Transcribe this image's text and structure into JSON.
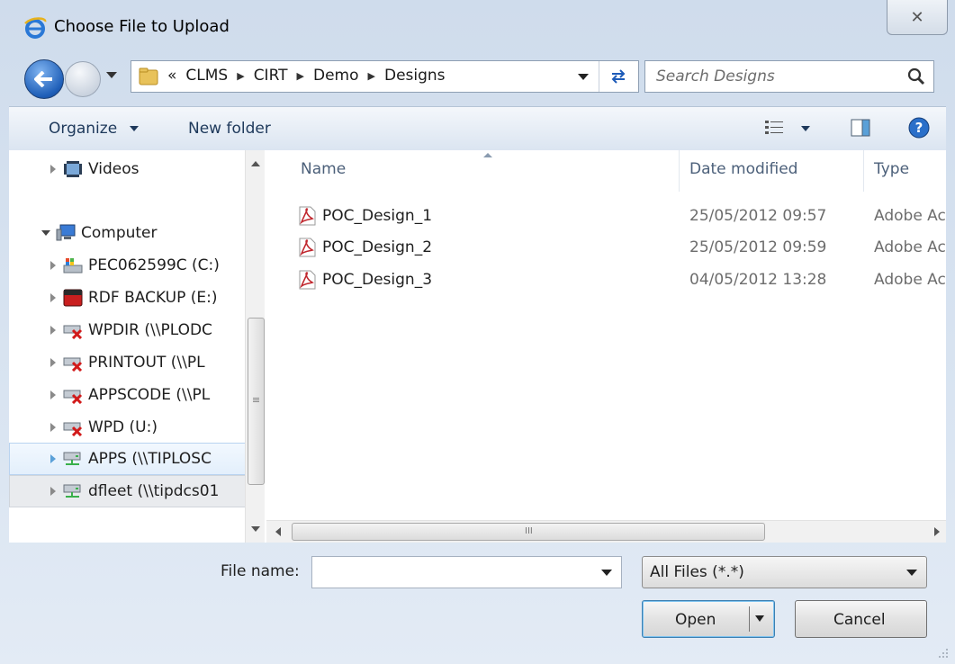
{
  "window": {
    "title": "Choose File to Upload",
    "close_label": "✕"
  },
  "address": {
    "overflow": "«",
    "crumbs": [
      "CLMS",
      "CIRT",
      "Demo",
      "Designs"
    ],
    "search_placeholder": "Search Designs"
  },
  "toolbar": {
    "organize_label": "Organize",
    "new_folder_label": "New folder"
  },
  "nav": {
    "items": [
      {
        "label": "Videos"
      },
      {
        "label": "Computer"
      },
      {
        "label": "PEC062599C (C:)"
      },
      {
        "label": "RDF BACKUP (E:)"
      },
      {
        "label": "WPDIR (\\\\PLODC"
      },
      {
        "label": "PRINTOUT (\\\\PL"
      },
      {
        "label": "APPSCODE (\\\\PL"
      },
      {
        "label": "WPD (U:)"
      },
      {
        "label": "APPS (\\\\TIPLOSC"
      },
      {
        "label": "dfleet (\\\\tipdcs01"
      }
    ]
  },
  "files": {
    "columns": {
      "name": "Name",
      "date": "Date modified",
      "type": "Type"
    },
    "rows": [
      {
        "name": "POC_Design_1",
        "date": "25/05/2012 09:57",
        "type": "Adobe Ac"
      },
      {
        "name": "POC_Design_2",
        "date": "25/05/2012 09:59",
        "type": "Adobe Ac"
      },
      {
        "name": "POC_Design_3",
        "date": "04/05/2012 13:28",
        "type": "Adobe Ac"
      }
    ],
    "hscroll_grip": "III"
  },
  "bottom": {
    "file_name_label": "File name:",
    "file_name_value": "",
    "file_type": "All Files (*.*)",
    "open_label": "Open",
    "cancel_label": "Cancel"
  },
  "colors": {
    "accent": "#1f5fb8",
    "selection": "#e3effc",
    "pdf": "#c0262d"
  }
}
